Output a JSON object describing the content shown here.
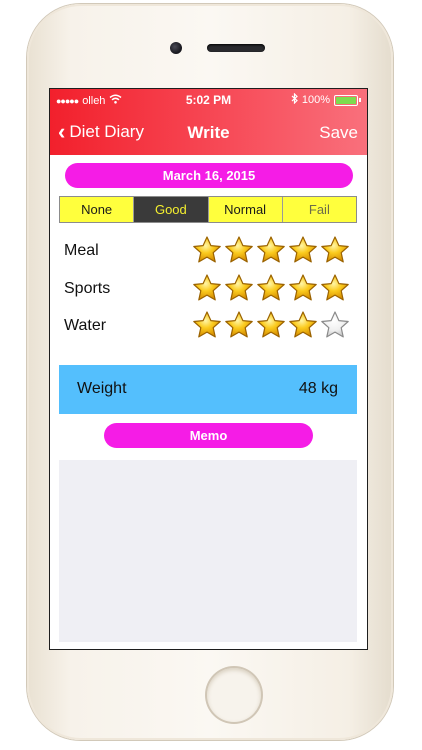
{
  "status_bar": {
    "signal": "●●●●●",
    "carrier": "olleh",
    "time": "5:02 PM",
    "battery": "100%"
  },
  "nav": {
    "back_label": "Diet Diary",
    "title": "Write",
    "save_label": "Save"
  },
  "date_label": "March 16, 2015",
  "segments": {
    "items": [
      "None",
      "Good",
      "Normal",
      "Fail"
    ],
    "selected": "Good"
  },
  "ratings": [
    {
      "label": "Meal",
      "stars": 5,
      "max": 5
    },
    {
      "label": "Sports",
      "stars": 5,
      "max": 5
    },
    {
      "label": "Water",
      "stars": 4,
      "max": 5
    }
  ],
  "weight": {
    "label": "Weight",
    "value": "48 kg"
  },
  "memo": {
    "button_label": "Memo",
    "text": ""
  },
  "colors": {
    "header_red": "#f2202c",
    "pill_magenta": "#f51ce6",
    "segment_yellow": "#ffff3d",
    "segment_selected": "#3a3a3a",
    "weight_blue": "#54bffd",
    "star_gold": "#f5b400"
  },
  "icons": {
    "back": "chevron-left-icon",
    "wifi": "wifi-icon",
    "bluetooth": "bluetooth-icon",
    "battery": "battery-icon",
    "star": "star-icon"
  }
}
